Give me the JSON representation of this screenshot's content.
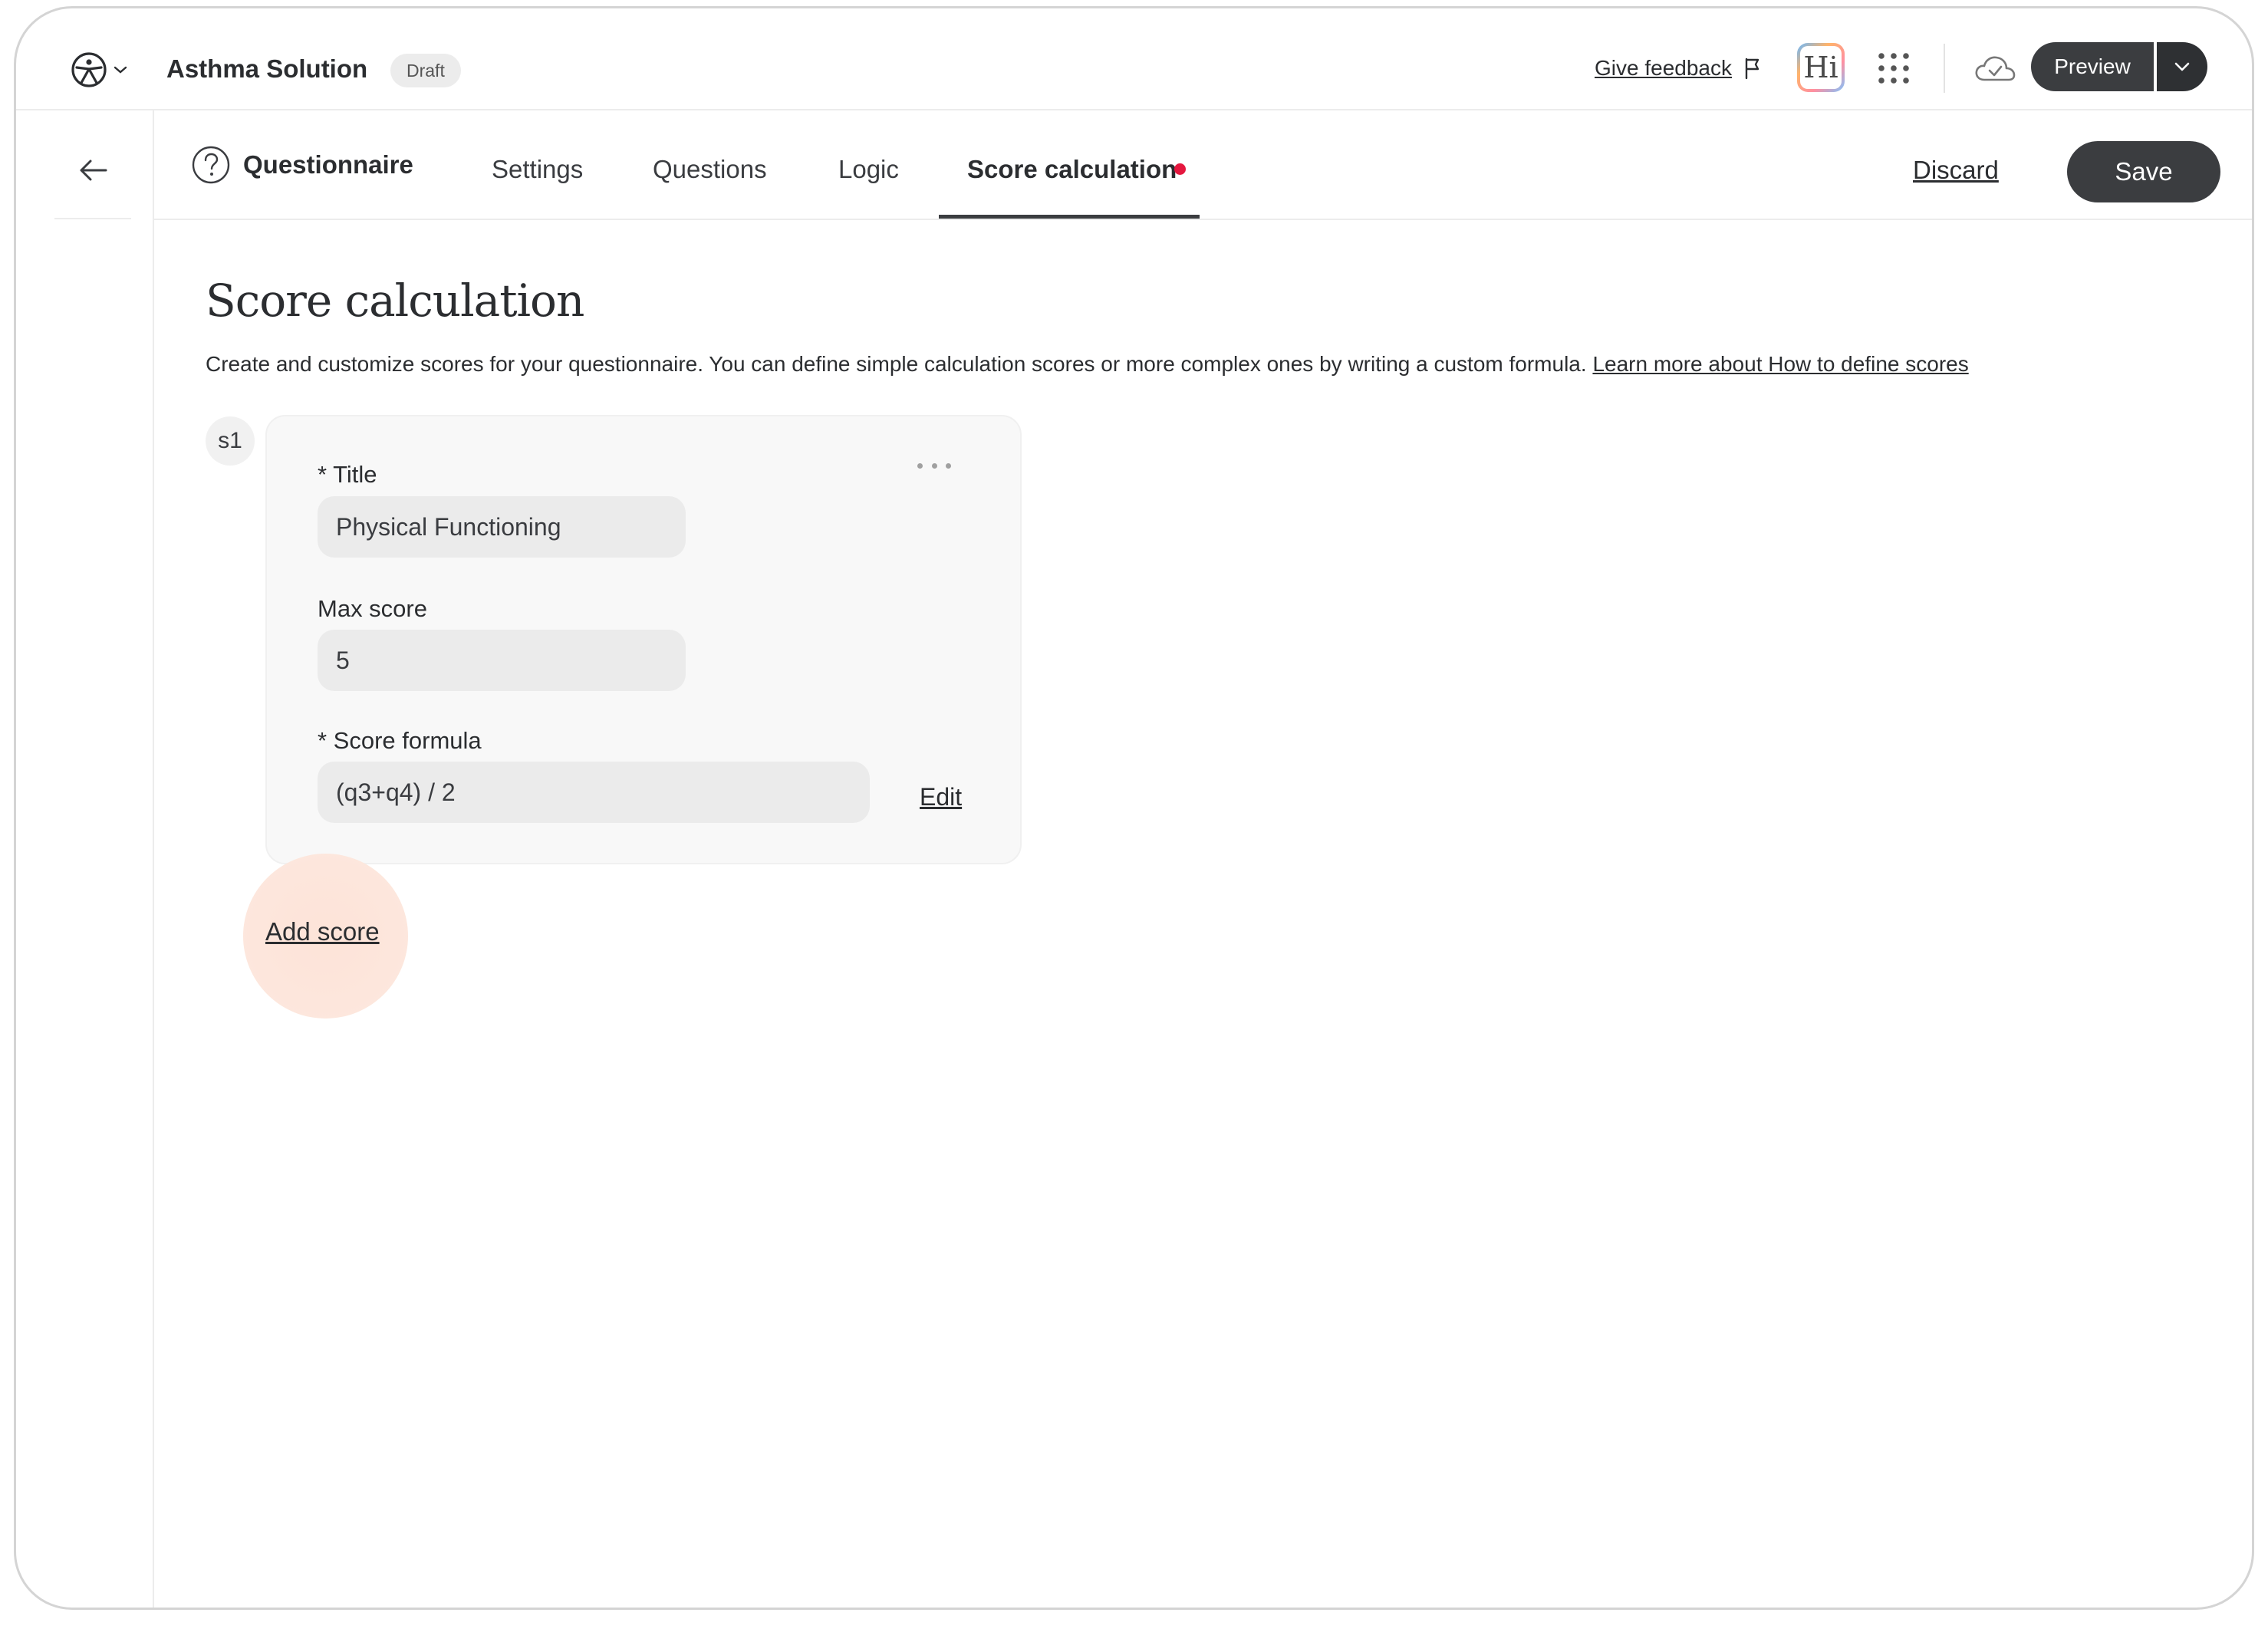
{
  "header": {
    "app_title": "Asthma Solution",
    "status_badge": "Draft",
    "feedback_label": "Give feedback",
    "hi_label": "Hi",
    "preview_label": "Preview"
  },
  "tabs": {
    "questionnaire_label": "Questionnaire",
    "items": [
      "Settings",
      "Questions",
      "Logic",
      "Score calculation"
    ],
    "active": "Score calculation",
    "discard_label": "Discard",
    "save_label": "Save"
  },
  "main": {
    "title": "Score calculation",
    "description": "Create and customize scores for your questionnaire. You can define simple calculation scores or more complex ones by writing a custom formula.",
    "learn_more_link": "Learn more about How to define scores",
    "scores": [
      {
        "id": "s1",
        "title_label": "* Title",
        "title_value": "Physical Functioning",
        "max_label": "Max score",
        "max_value": "5",
        "formula_label": "* Score formula",
        "formula_value": "(q3+q4) / 2",
        "edit_label": "Edit"
      }
    ],
    "add_score_label": "Add score"
  },
  "colors": {
    "accent_dark": "#3b3d40",
    "unsaved_dot": "#e5173f",
    "field_bg": "#ebebeb",
    "card_bg": "#f8f8f8"
  },
  "icons": [
    "person-logo-icon",
    "chevron-down-icon",
    "flag-icon",
    "apps-grid-icon",
    "cloud-check-icon",
    "arrow-left-icon",
    "question-circle-icon",
    "more-horizontal-icon"
  ]
}
